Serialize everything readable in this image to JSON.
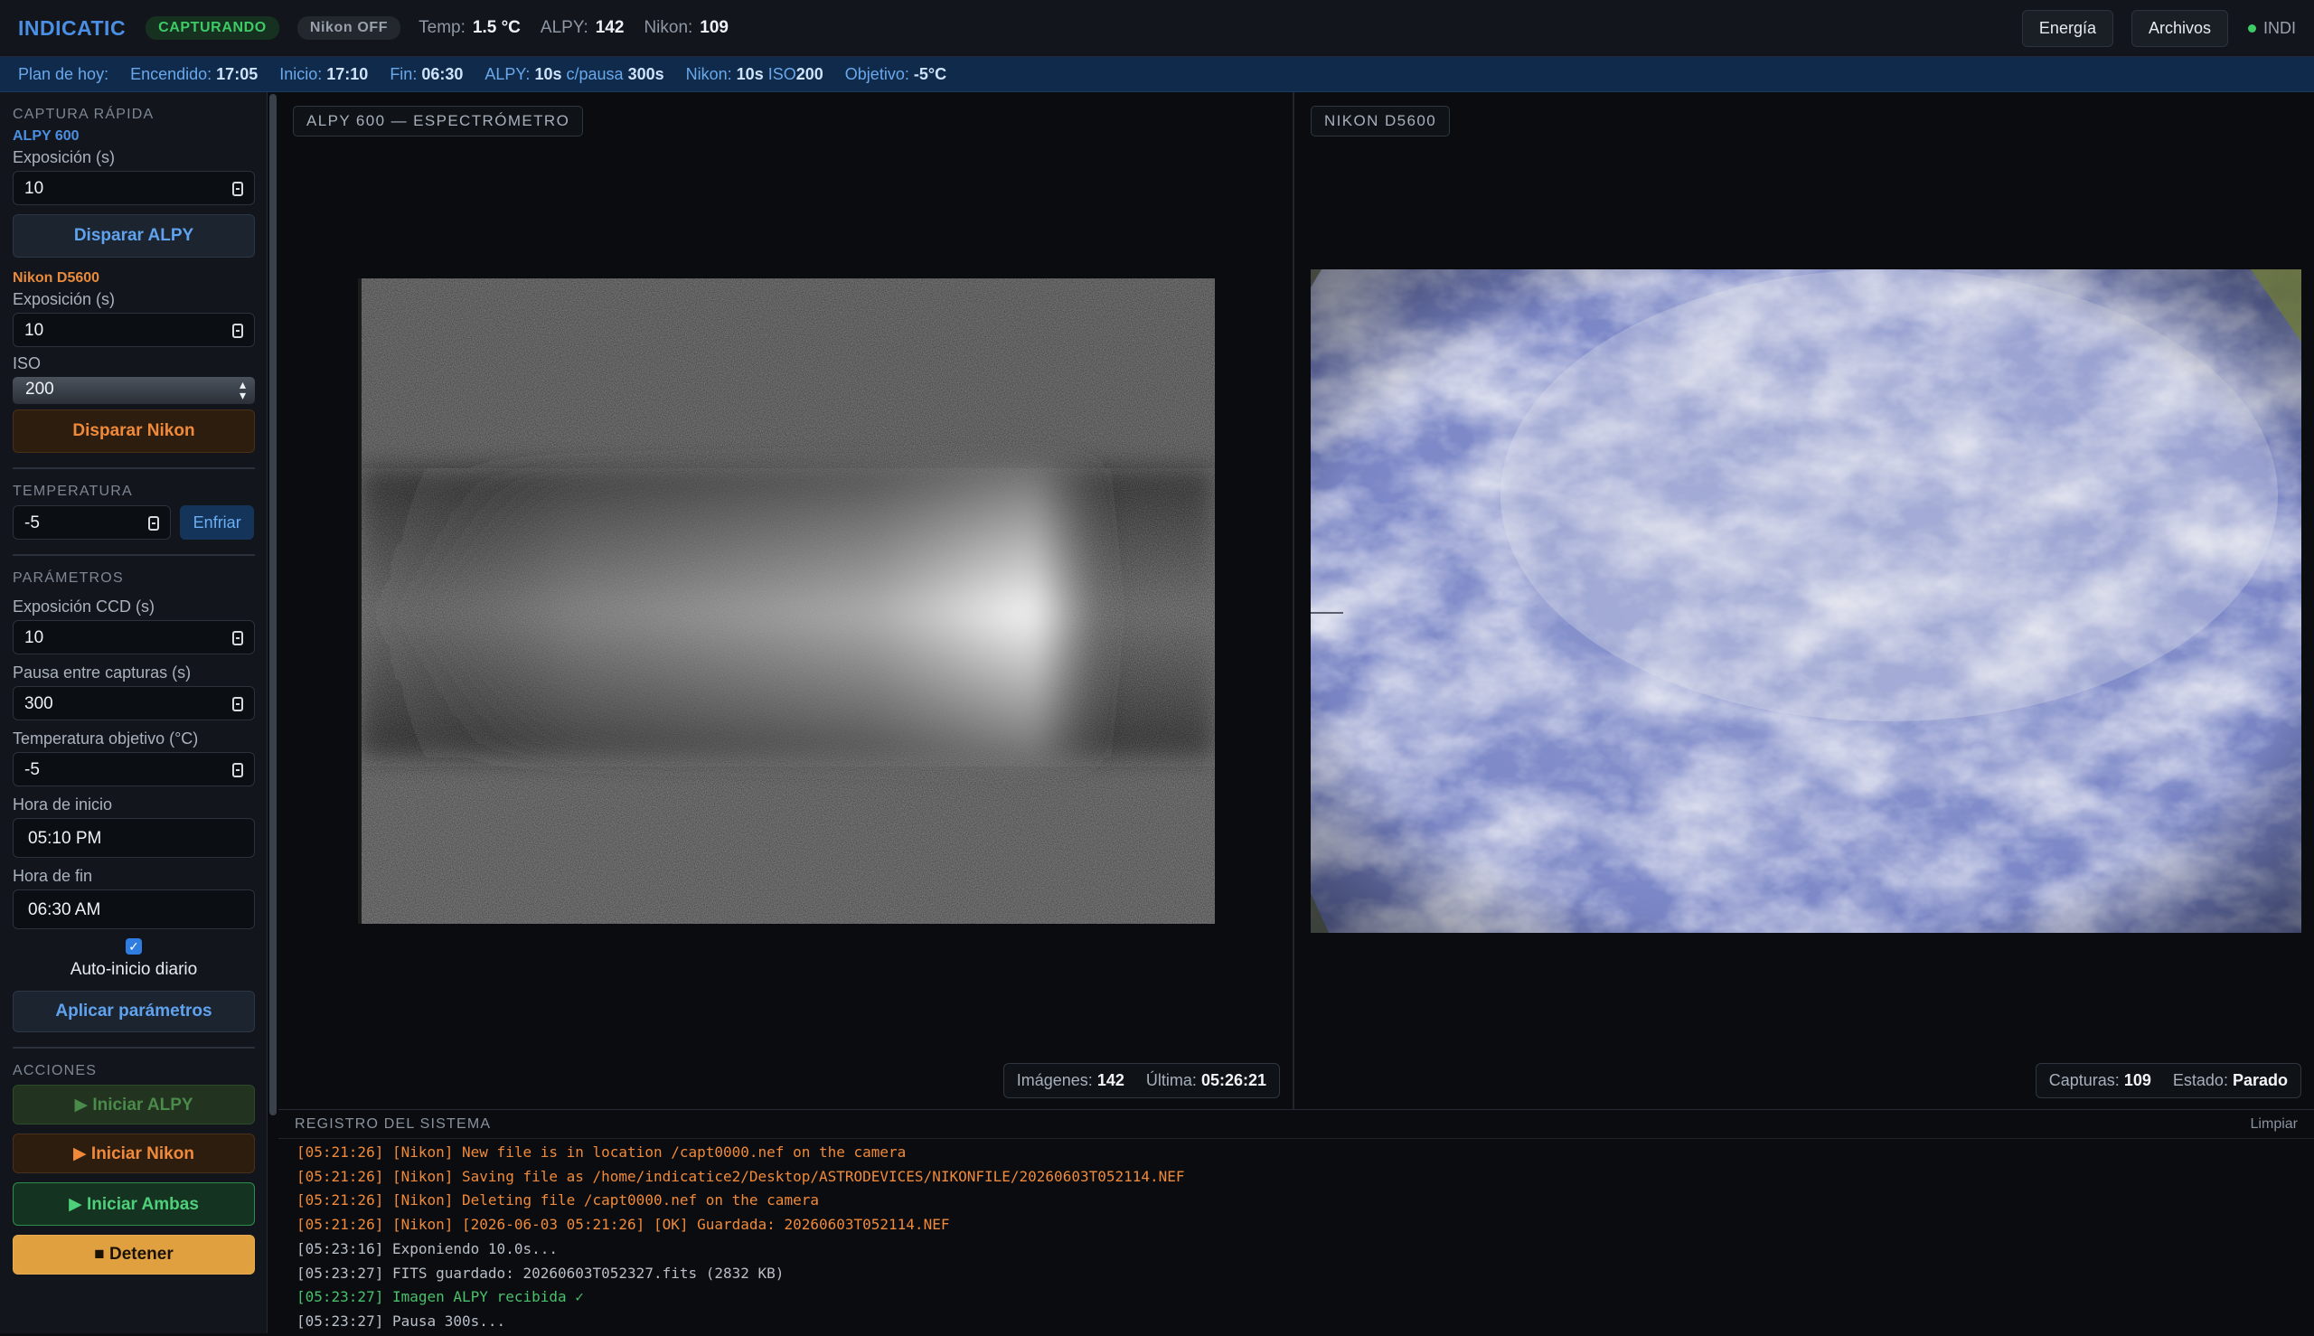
{
  "topbar": {
    "brand": "INDICATIC",
    "status_badge": "CAPTURANDO",
    "nikon_badge": "Nikon OFF",
    "temp_label": "Temp:",
    "temp_value": "1.5 °C",
    "alpy_label": "ALPY:",
    "alpy_value": "142",
    "nikon_label": "Nikon:",
    "nikon_value": "109",
    "btn_energy": "Energía",
    "btn_files": "Archivos",
    "indi_label": "INDI"
  },
  "plan": {
    "title": "Plan de hoy:",
    "power_on_label": "Encendido:",
    "power_on": "17:05",
    "start_label": "Inicio:",
    "start": "17:10",
    "end_label": "Fin:",
    "end": "06:30",
    "alpy_label": "ALPY:",
    "alpy_exp": "10s",
    "alpy_mid": "c/pausa",
    "alpy_pause": "300s",
    "nikon_label": "Nikon:",
    "nikon_exp": "10s",
    "nikon_iso_label": "ISO",
    "nikon_iso": "200",
    "target_label": "Objetivo:",
    "target": "-5°C"
  },
  "sidebar": {
    "quick_title": "CAPTURA RÁPIDA",
    "alpy_title": "ALPY 600",
    "alpy_exp_label": "Exposición (s)",
    "alpy_exp_value": "10",
    "alpy_fire": "Disparar ALPY",
    "nikon_title": "Nikon D5600",
    "nikon_exp_label": "Exposición (s)",
    "nikon_exp_value": "10",
    "iso_label": "ISO",
    "iso_value": "200",
    "nikon_fire": "Disparar Nikon",
    "temp_title": "TEMPERATURA",
    "temp_value": "-5",
    "cool_btn": "Enfriar",
    "params_title": "PARÁMETROS",
    "ccd_exp_label": "Exposición CCD (s)",
    "ccd_exp_value": "10",
    "pause_label": "Pausa entre capturas (s)",
    "pause_value": "300",
    "target_temp_label": "Temperatura objetivo (°C)",
    "target_temp_value": "-5",
    "start_time_label": "Hora de inicio",
    "start_time_value": "05:10 PM",
    "end_time_label": "Hora de fin",
    "end_time_value": "06:30 AM",
    "auto_start_label": "Auto-inicio diario",
    "auto_start_checked": true,
    "apply_btn": "Aplicar parámetros",
    "actions_title": "ACCIONES",
    "start_alpy": "▶ Iniciar ALPY",
    "start_nikon": "▶ Iniciar Nikon",
    "start_both": "▶ Iniciar Ambas",
    "stop": "■ Detener"
  },
  "panels": {
    "alpy": {
      "label": "ALPY 600 — ESPECTRÓMETRO",
      "images_label": "Imágenes:",
      "images_value": "142",
      "last_label": "Última:",
      "last_value": "05:26:21"
    },
    "nikon": {
      "label": "NIKON D5600",
      "captures_label": "Capturas:",
      "captures_value": "109",
      "state_label": "Estado:",
      "state_value": "Parado"
    }
  },
  "log": {
    "title": "REGISTRO DEL SISTEMA",
    "clear": "Limpiar",
    "lines": [
      {
        "text": "[05:21:26] [Nikon] New file is in location /capt0000.nef on the camera",
        "kind": "nikon"
      },
      {
        "text": "[05:21:26] [Nikon] Saving file as /home/indicatice2/Desktop/ASTRODEVICES/NIKONFILE/20260603T052114.NEF",
        "kind": "nikon"
      },
      {
        "text": "[05:21:26] [Nikon] Deleting file /capt0000.nef on the camera",
        "kind": "nikon"
      },
      {
        "text": "[05:21:26] [Nikon] [2026-06-03 05:21:26] [OK] Guardada: 20260603T052114.NEF",
        "kind": "nikon"
      },
      {
        "text": "[05:23:16] Exponiendo 10.0s...",
        "kind": "plain"
      },
      {
        "text": "[05:23:27] FITS guardado: 20260603T052327.fits (2832 KB)",
        "kind": "plain"
      },
      {
        "text": "[05:23:27] Imagen ALPY recibida ✓",
        "kind": "ok"
      },
      {
        "text": "[05:23:27] Pausa 300s...",
        "kind": "plain"
      }
    ]
  },
  "colors": {
    "accent_blue": "#4a8fe3",
    "nikon_orange": "#f08a3a",
    "ok_green": "#3ecb66",
    "stop_amber": "#e0a040"
  }
}
